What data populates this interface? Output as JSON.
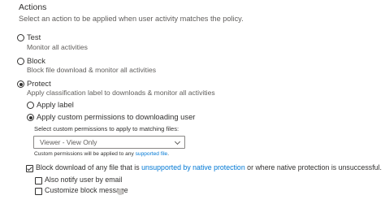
{
  "actions": {
    "title": "Actions",
    "description": "Select an action to be applied when user activity matches the policy."
  },
  "options": {
    "test": {
      "label": "Test",
      "description": "Monitor all activities",
      "selected": false
    },
    "block": {
      "label": "Block",
      "description": "Block file download & monitor all activities",
      "selected": false
    },
    "protect": {
      "label": "Protect",
      "description": "Apply classification label to downloads & monitor all activities",
      "selected": true
    }
  },
  "protect_options": {
    "apply_label": {
      "label": "Apply label",
      "selected": false
    },
    "apply_custom": {
      "label": "Apply custom permissions to downloading user",
      "selected": true
    }
  },
  "permissions": {
    "dropdown_label": "Select custom permissions to apply to matching files:",
    "selected_value": "Viewer - View Only",
    "note_prefix": "Custom permissions will be applied to any ",
    "note_link": "supported file",
    "note_suffix": "."
  },
  "block_download": {
    "checked": true,
    "prefix": "Block download of any file that is ",
    "link": "unsupported by native protection",
    "suffix": " or where native protection is unsuccessful."
  },
  "notify": {
    "label": "Also notify user by email",
    "checked": false
  },
  "customize": {
    "label": "Customize block message",
    "checked": false
  },
  "icons": {
    "info": "info-icon"
  }
}
